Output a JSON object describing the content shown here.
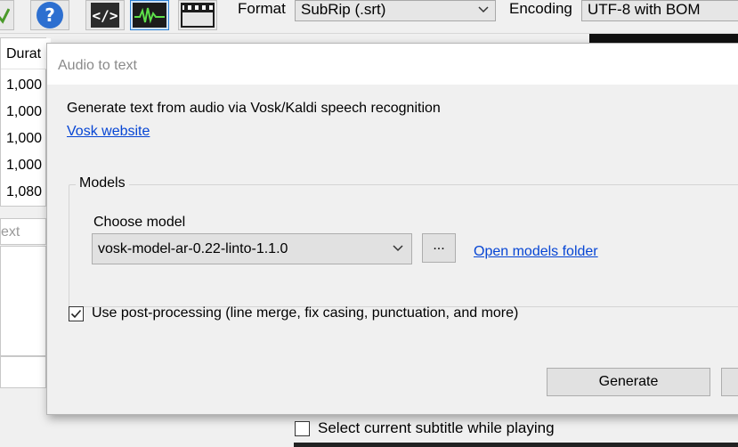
{
  "toolbar": {
    "format_label": "Format",
    "format_value": "SubRip (.srt)",
    "encoding_label": "Encoding",
    "encoding_value": "UTF-8 with BOM"
  },
  "grid": {
    "header": "Durat",
    "rows": [
      "1,000",
      "1,000",
      "1,000",
      "1,000",
      "1,080"
    ]
  },
  "text_box_placeholder": "ext",
  "dialog": {
    "title": "Audio to text",
    "description": "Generate text from audio via Vosk/Kaldi speech recognition",
    "website_link": "Vosk website",
    "models_group": "Models",
    "choose_model_label": "Choose model",
    "selected_model": "vosk-model-ar-0.22-linto-1.1.0",
    "browse_button": "...",
    "open_models_folder": "Open models folder",
    "post_processing_label": "Use post-processing (line merge, fix casing, punctuation, and more)",
    "post_processing_checked": true,
    "generate_button": "Generate"
  },
  "below": {
    "select_current_label": "Select current subtitle while playing",
    "select_current_checked": false
  },
  "colors": {
    "link": "#0645d4",
    "active_button_border": "#2a7fd4"
  }
}
